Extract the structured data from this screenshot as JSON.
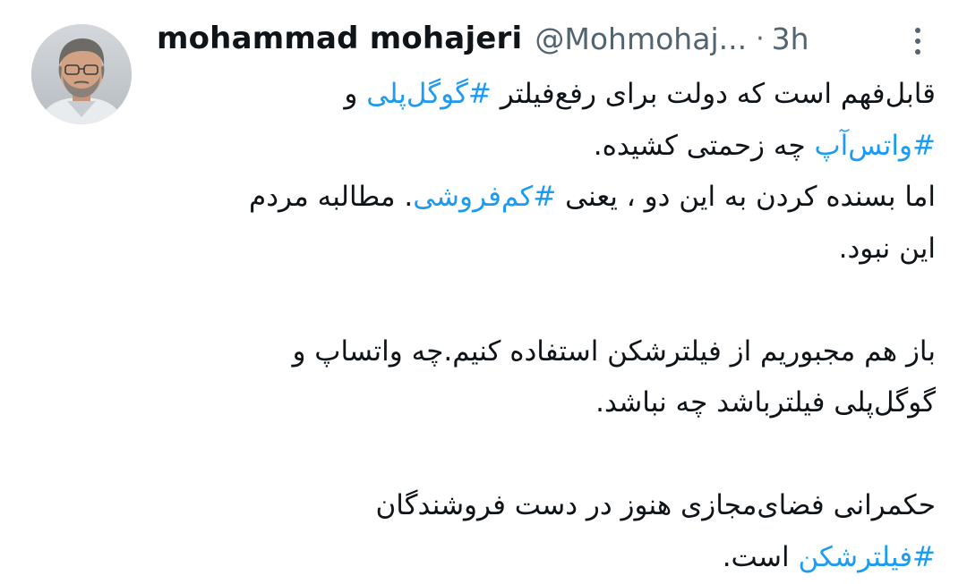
{
  "tweet": {
    "author": {
      "display_name": "mohammad mohajeri",
      "handle": "@Mohmohaj...",
      "avatar_icon": "profile-photo"
    },
    "separator": "·",
    "time": "3h",
    "more_icon": "more-vertical-icon",
    "paragraphs": [
      {
        "lines": [
          {
            "segments": [
              {
                "t": "قابل‌فهم است که دولت برای رفع‌فیلتر "
              },
              {
                "t": "#گوگل‌پلی",
                "tag": true
              },
              {
                "t": " و"
              }
            ]
          },
          {
            "segments": [
              {
                "t": "#واتس‌آپ",
                "tag": true
              },
              {
                "t": " چه  زحمتی کشیده."
              }
            ]
          },
          {
            "segments": [
              {
                "t": "اما بسنده کردن به این دو ، یعنی "
              },
              {
                "t": "#کم‌فروشی",
                "tag": true
              },
              {
                "t": ". مطالبه مردم"
              }
            ]
          },
          {
            "segments": [
              {
                "t": "این نبود."
              }
            ]
          }
        ]
      },
      {
        "lines": [
          {
            "segments": [
              {
                "t": " باز هم مجبوریم از فیلترشکن استفاده کنیم.چه واتساپ و"
              }
            ]
          },
          {
            "segments": [
              {
                "t": "گوگل‌پلی فیلترباشد چه نباشد."
              }
            ]
          }
        ]
      },
      {
        "lines": [
          {
            "segments": [
              {
                "t": "حکمرانی فضای‌مجازی هنوز در دست فروشندگان"
              }
            ]
          },
          {
            "segments": [
              {
                "t": "#فیلترشکن",
                "tag": true
              },
              {
                "t": " است."
              }
            ]
          }
        ]
      }
    ],
    "colors": {
      "text": "#0f1419",
      "secondary": "#536471",
      "link": "#1d9bf0"
    }
  }
}
